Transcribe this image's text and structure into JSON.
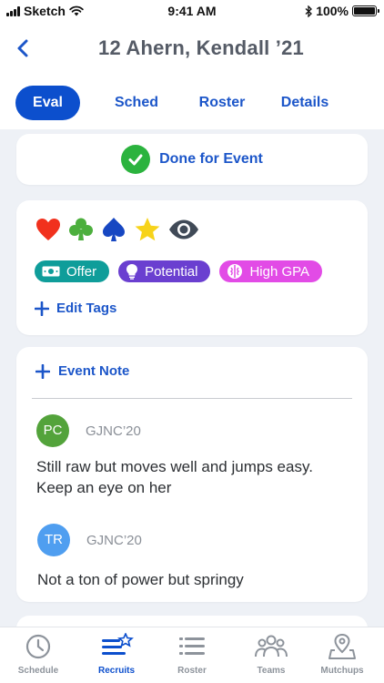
{
  "status_bar": {
    "carrier": "Sketch",
    "time": "9:41 AM",
    "battery": "100%"
  },
  "header": {
    "title": "12 Ahern, Kendall ’21",
    "back_icon": "chevron-left-icon"
  },
  "tabs": [
    {
      "label": "Eval",
      "active": true
    },
    {
      "label": "Sched",
      "active": false
    },
    {
      "label": "Roster",
      "active": false
    },
    {
      "label": "Details",
      "active": false
    }
  ],
  "done": {
    "label": "Done for Event",
    "icon": "check-circle-icon"
  },
  "tag_icons": [
    "heart-icon",
    "club-icon",
    "spade-icon",
    "star-icon",
    "eye-icon"
  ],
  "pills": [
    {
      "label": "Offer",
      "icon": "money-icon",
      "color": "#0f9d9a"
    },
    {
      "label": "Potential",
      "icon": "lightbulb-icon",
      "color": "#6a3fd0"
    },
    {
      "label": "High GPA",
      "icon": "brain-icon",
      "color": "#e24be6"
    }
  ],
  "edit_tags": {
    "label": "Edit Tags"
  },
  "event_note": {
    "label": "Event Note"
  },
  "notes": [
    {
      "initials": "PC",
      "source": "GJNC’20",
      "text": "Still raw but moves well and jumps easy. Keep an eye on her",
      "color": "#53a33b"
    },
    {
      "initials": "TR",
      "source": "GJNC’20",
      "text": "Not a ton of power but springy",
      "color": "#4f9ef0"
    }
  ],
  "bottom_nav": [
    {
      "label": "Schedule",
      "icon": "clock-icon",
      "active": false
    },
    {
      "label": "Recruits",
      "icon": "list-star-icon",
      "active": true
    },
    {
      "label": "Roster",
      "icon": "list-icon",
      "active": false
    },
    {
      "label": "Teams",
      "icon": "people-icon",
      "active": false
    },
    {
      "label": "Mutchups",
      "icon": "map-pin-icon",
      "active": false
    }
  ],
  "colors": {
    "accent": "#0c4fcd",
    "link": "#1c56c9",
    "background": "#eef1f6"
  }
}
